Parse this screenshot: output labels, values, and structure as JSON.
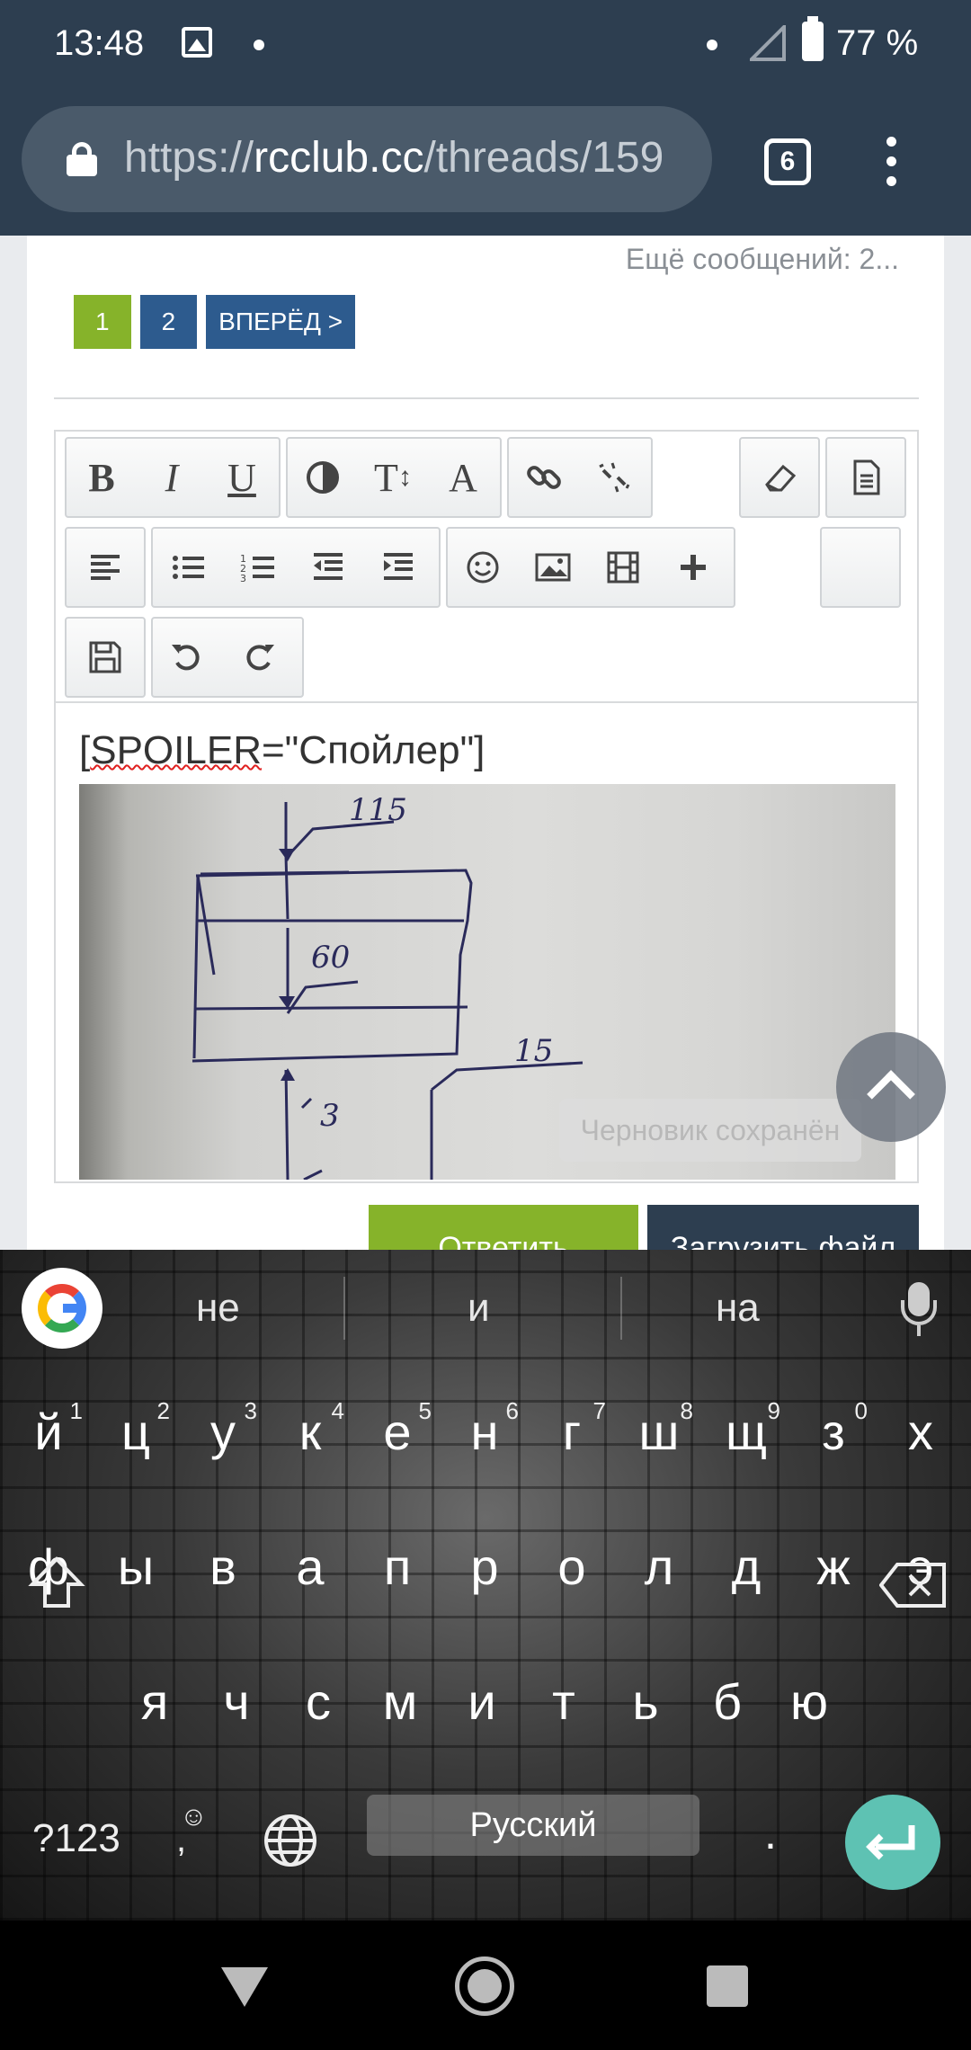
{
  "status_bar": {
    "time": "13:48",
    "battery": "77 %"
  },
  "browser": {
    "url_scheme": "https://",
    "url_domain": "rcclub.cc",
    "url_path": "/threads/159",
    "tab_count": "6"
  },
  "thread": {
    "more_messages": "Ещё сообщений: 2...",
    "pagination": {
      "page1": "1",
      "page2": "2",
      "next": "ВПЕРЁД >"
    }
  },
  "editor": {
    "toolbar": {
      "bold": "B",
      "italic": "I",
      "underline": "U",
      "font_size": "T",
      "font_family": "A"
    },
    "content_prefix": "[",
    "content_spoiler": "SPOILER",
    "content_suffix": "=\"Спойлер\"]",
    "image_annotations": [
      "115",
      "60",
      "15",
      "3"
    ],
    "draft_saved": "Черновик сохранён"
  },
  "actions": {
    "reply": "Ответить",
    "upload": "Загрузить файл"
  },
  "keyboard": {
    "suggestions": [
      "не",
      "и",
      "на"
    ],
    "row1": [
      {
        "k": "й",
        "h": "1"
      },
      {
        "k": "ц",
        "h": "2"
      },
      {
        "k": "у",
        "h": "3"
      },
      {
        "k": "к",
        "h": "4"
      },
      {
        "k": "е",
        "h": "5"
      },
      {
        "k": "н",
        "h": "6"
      },
      {
        "k": "г",
        "h": "7"
      },
      {
        "k": "ш",
        "h": "8"
      },
      {
        "k": "щ",
        "h": "9"
      },
      {
        "k": "з",
        "h": "0"
      },
      {
        "k": "х",
        "h": ""
      }
    ],
    "row2": [
      "ф",
      "ы",
      "в",
      "а",
      "п",
      "р",
      "о",
      "л",
      "д",
      "ж",
      "э"
    ],
    "row3": [
      "я",
      "ч",
      "с",
      "м",
      "и",
      "т",
      "ь",
      "б",
      "ю"
    ],
    "mode_key": "?123",
    "comma": ",",
    "space_label": "Русский",
    "period": ".",
    "accent_color": "#5ec2b3"
  }
}
